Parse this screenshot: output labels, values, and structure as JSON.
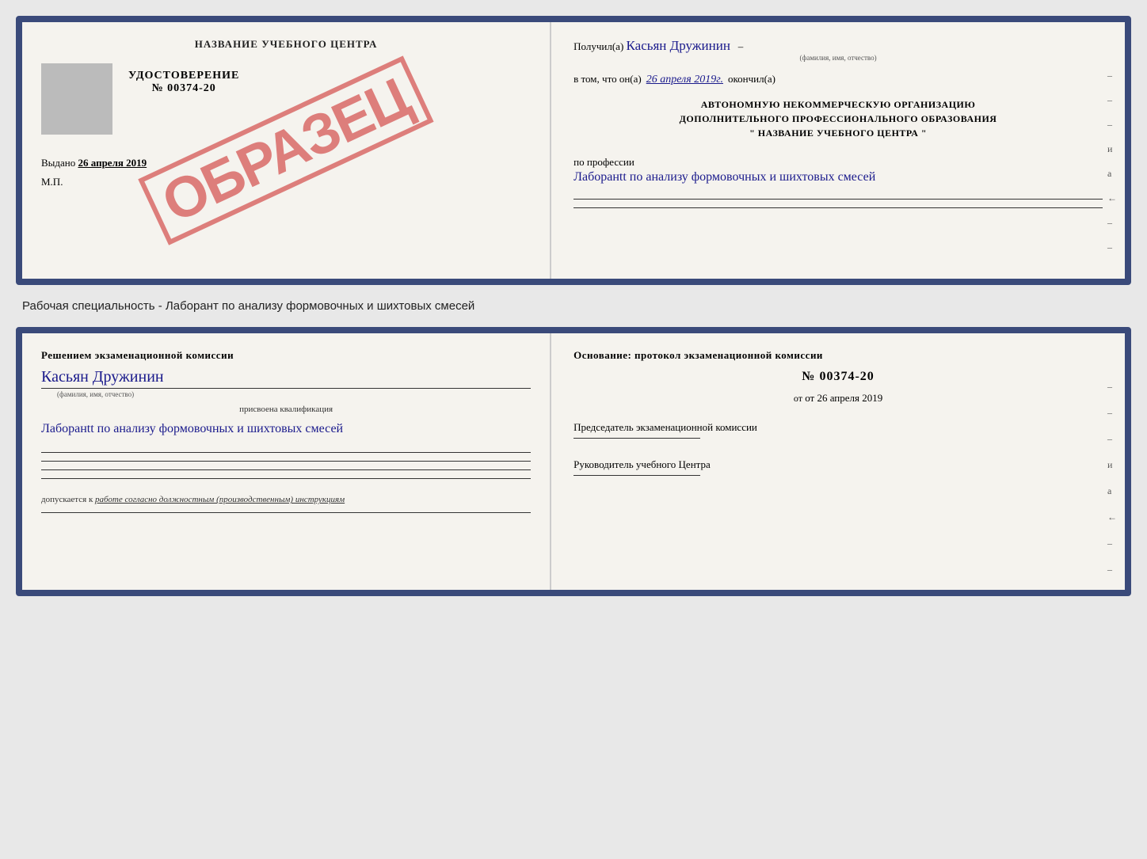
{
  "top_card": {
    "left": {
      "title": "НАЗВАНИЕ УЧЕБНОГО ЦЕНТРА",
      "stamp": "ОБРАЗЕЦ",
      "udost": "УДОСТОВЕРЕНИЕ",
      "number": "№ 00374-20",
      "vydano": "Выдано",
      "vydano_date": "26 апреля 2019",
      "mp": "М.П."
    },
    "right": {
      "poluchil": "Получил(а)",
      "name_handwritten": "Касьян Дружинин",
      "fio_label": "(фамилия, имя, отчество)",
      "vtom": "в том, что он(а)",
      "date_handwritten": "26 апреля 2019г.",
      "okonchil": "окончил(а)",
      "org_line1": "АВТОНОМНУЮ НЕКОММЕРЧЕСКУЮ ОРГАНИЗАЦИЮ",
      "org_line2": "ДОПОЛНИТЕЛЬНОГО ПРОФЕССИОНАЛЬНОГО ОБРАЗОВАНИЯ",
      "org_line3": "\"     НАЗВАНИЕ УЧЕБНОГО ЦЕНТРА     \"",
      "po_professii": "по профессии",
      "prof_handwritten": "Лаборанtt по анализу формовочных и шихтовых смесей",
      "dashes": [
        "-",
        "-",
        "-",
        "и",
        "а",
        "←",
        "-",
        "-"
      ]
    }
  },
  "specialty_text": "Рабочая специальность - Лаборант по анализу формовочных и шихтовых смесей",
  "bottom_card": {
    "left": {
      "resheniyem": "Решением экзаменационной комиссии",
      "name_handwritten": "Касьян Дружинин",
      "fio_label": "(фамилия, имя, отчество)",
      "prisvoyena": "присвоена квалификация",
      "kvali_handwritten": "Лаборанtt по анализу формовочных и шихтовых смесей",
      "dopuskaetsya": "допускается к",
      "work_label": "работе согласно должностным (производственным) инструкциям"
    },
    "right": {
      "osnovaniye": "Основание: протокол экзаменационной комиссии",
      "number": "№ 00374-20",
      "ot": "от 26 апреля 2019",
      "predsedatel_label": "Председатель экзаменационной комиссии",
      "rukovoditel_label": "Руководитель учебного Центра",
      "dashes": [
        "-",
        "-",
        "-",
        "и",
        "а",
        "←",
        "-",
        "-"
      ]
    }
  }
}
